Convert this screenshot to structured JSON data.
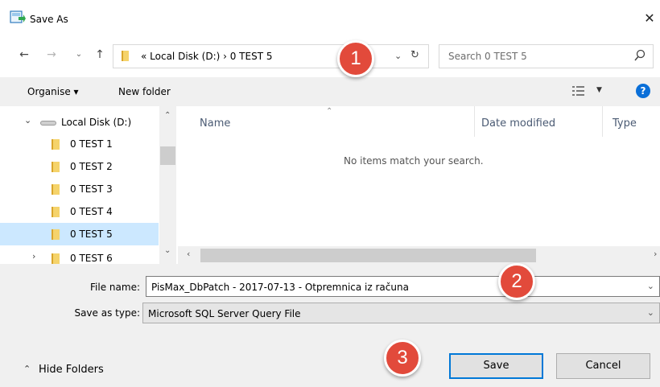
{
  "window": {
    "title": "Save As"
  },
  "address": {
    "path": "« Local Disk (D:) › 0 TEST 5"
  },
  "search": {
    "placeholder": "Search 0 TEST 5"
  },
  "toolbar": {
    "organise_label": "Organise ▾",
    "new_folder_label": "New folder"
  },
  "nav_tree": {
    "root_label": "Local Disk (D:)",
    "items": [
      {
        "label": "0 TEST 1"
      },
      {
        "label": "0 TEST 2"
      },
      {
        "label": "0 TEST 3"
      },
      {
        "label": "0 TEST 4"
      },
      {
        "label": "0 TEST 5"
      },
      {
        "label": "0 TEST 6"
      }
    ],
    "selected": "0 TEST 5"
  },
  "columns": {
    "name": "Name",
    "date_modified": "Date modified",
    "type": "Type"
  },
  "content": {
    "empty_message": "No items match your search."
  },
  "form": {
    "file_name_label": "File name:",
    "file_name_value": "PisMax_DbPatch - 2017-07-13 - Otpremnica iz računa",
    "save_type_label": "Save as type:",
    "save_type_value": "Microsoft SQL Server Query File"
  },
  "footer": {
    "hide_folders_label": "Hide Folders",
    "save_label": "Save",
    "cancel_label": "Cancel"
  },
  "callouts": [
    "1",
    "2",
    "3"
  ],
  "colors": {
    "accent": "#0078d7",
    "selection": "#cce8ff",
    "callout": "#e24a3b",
    "help": "#0a6fd8"
  }
}
